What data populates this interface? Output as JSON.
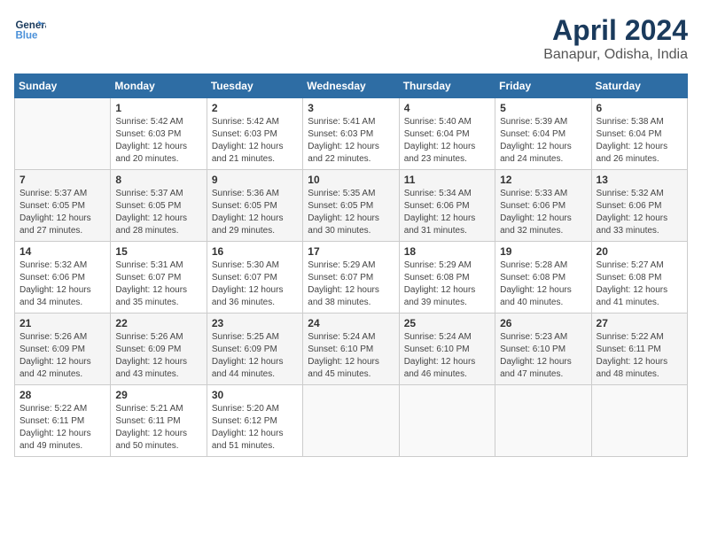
{
  "header": {
    "logo_line1": "General",
    "logo_line2": "Blue",
    "title": "April 2024",
    "subtitle": "Banapur, Odisha, India"
  },
  "columns": [
    "Sunday",
    "Monday",
    "Tuesday",
    "Wednesday",
    "Thursday",
    "Friday",
    "Saturday"
  ],
  "weeks": [
    [
      {
        "num": "",
        "info": ""
      },
      {
        "num": "1",
        "info": "Sunrise: 5:42 AM\nSunset: 6:03 PM\nDaylight: 12 hours\nand 20 minutes."
      },
      {
        "num": "2",
        "info": "Sunrise: 5:42 AM\nSunset: 6:03 PM\nDaylight: 12 hours\nand 21 minutes."
      },
      {
        "num": "3",
        "info": "Sunrise: 5:41 AM\nSunset: 6:03 PM\nDaylight: 12 hours\nand 22 minutes."
      },
      {
        "num": "4",
        "info": "Sunrise: 5:40 AM\nSunset: 6:04 PM\nDaylight: 12 hours\nand 23 minutes."
      },
      {
        "num": "5",
        "info": "Sunrise: 5:39 AM\nSunset: 6:04 PM\nDaylight: 12 hours\nand 24 minutes."
      },
      {
        "num": "6",
        "info": "Sunrise: 5:38 AM\nSunset: 6:04 PM\nDaylight: 12 hours\nand 26 minutes."
      }
    ],
    [
      {
        "num": "7",
        "info": "Sunrise: 5:37 AM\nSunset: 6:05 PM\nDaylight: 12 hours\nand 27 minutes."
      },
      {
        "num": "8",
        "info": "Sunrise: 5:37 AM\nSunset: 6:05 PM\nDaylight: 12 hours\nand 28 minutes."
      },
      {
        "num": "9",
        "info": "Sunrise: 5:36 AM\nSunset: 6:05 PM\nDaylight: 12 hours\nand 29 minutes."
      },
      {
        "num": "10",
        "info": "Sunrise: 5:35 AM\nSunset: 6:05 PM\nDaylight: 12 hours\nand 30 minutes."
      },
      {
        "num": "11",
        "info": "Sunrise: 5:34 AM\nSunset: 6:06 PM\nDaylight: 12 hours\nand 31 minutes."
      },
      {
        "num": "12",
        "info": "Sunrise: 5:33 AM\nSunset: 6:06 PM\nDaylight: 12 hours\nand 32 minutes."
      },
      {
        "num": "13",
        "info": "Sunrise: 5:32 AM\nSunset: 6:06 PM\nDaylight: 12 hours\nand 33 minutes."
      }
    ],
    [
      {
        "num": "14",
        "info": "Sunrise: 5:32 AM\nSunset: 6:06 PM\nDaylight: 12 hours\nand 34 minutes."
      },
      {
        "num": "15",
        "info": "Sunrise: 5:31 AM\nSunset: 6:07 PM\nDaylight: 12 hours\nand 35 minutes."
      },
      {
        "num": "16",
        "info": "Sunrise: 5:30 AM\nSunset: 6:07 PM\nDaylight: 12 hours\nand 36 minutes."
      },
      {
        "num": "17",
        "info": "Sunrise: 5:29 AM\nSunset: 6:07 PM\nDaylight: 12 hours\nand 38 minutes."
      },
      {
        "num": "18",
        "info": "Sunrise: 5:29 AM\nSunset: 6:08 PM\nDaylight: 12 hours\nand 39 minutes."
      },
      {
        "num": "19",
        "info": "Sunrise: 5:28 AM\nSunset: 6:08 PM\nDaylight: 12 hours\nand 40 minutes."
      },
      {
        "num": "20",
        "info": "Sunrise: 5:27 AM\nSunset: 6:08 PM\nDaylight: 12 hours\nand 41 minutes."
      }
    ],
    [
      {
        "num": "21",
        "info": "Sunrise: 5:26 AM\nSunset: 6:09 PM\nDaylight: 12 hours\nand 42 minutes."
      },
      {
        "num": "22",
        "info": "Sunrise: 5:26 AM\nSunset: 6:09 PM\nDaylight: 12 hours\nand 43 minutes."
      },
      {
        "num": "23",
        "info": "Sunrise: 5:25 AM\nSunset: 6:09 PM\nDaylight: 12 hours\nand 44 minutes."
      },
      {
        "num": "24",
        "info": "Sunrise: 5:24 AM\nSunset: 6:10 PM\nDaylight: 12 hours\nand 45 minutes."
      },
      {
        "num": "25",
        "info": "Sunrise: 5:24 AM\nSunset: 6:10 PM\nDaylight: 12 hours\nand 46 minutes."
      },
      {
        "num": "26",
        "info": "Sunrise: 5:23 AM\nSunset: 6:10 PM\nDaylight: 12 hours\nand 47 minutes."
      },
      {
        "num": "27",
        "info": "Sunrise: 5:22 AM\nSunset: 6:11 PM\nDaylight: 12 hours\nand 48 minutes."
      }
    ],
    [
      {
        "num": "28",
        "info": "Sunrise: 5:22 AM\nSunset: 6:11 PM\nDaylight: 12 hours\nand 49 minutes."
      },
      {
        "num": "29",
        "info": "Sunrise: 5:21 AM\nSunset: 6:11 PM\nDaylight: 12 hours\nand 50 minutes."
      },
      {
        "num": "30",
        "info": "Sunrise: 5:20 AM\nSunset: 6:12 PM\nDaylight: 12 hours\nand 51 minutes."
      },
      {
        "num": "",
        "info": ""
      },
      {
        "num": "",
        "info": ""
      },
      {
        "num": "",
        "info": ""
      },
      {
        "num": "",
        "info": ""
      }
    ]
  ]
}
